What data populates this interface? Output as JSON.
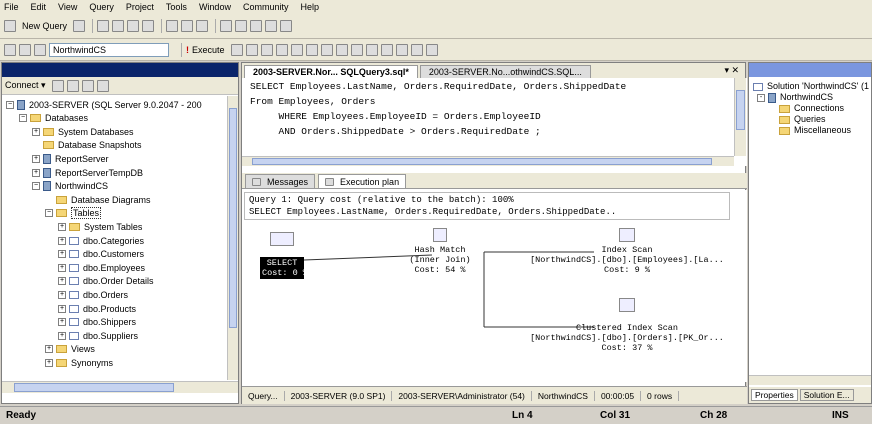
{
  "menu": [
    "File",
    "Edit",
    "View",
    "Query",
    "Project",
    "Tools",
    "Window",
    "Community",
    "Help"
  ],
  "toolbar": {
    "new_query_label": "New Query",
    "execute_label": "Execute",
    "database": "NorthwindCS"
  },
  "object_explorer": {
    "connect_label": "Connect ▾",
    "tree": [
      {
        "label": "2003-SERVER (SQL Server 9.0.2047 - 200",
        "indent": 0,
        "type": "server",
        "expander": "-"
      },
      {
        "label": "Databases",
        "indent": 1,
        "type": "folder",
        "expander": "-"
      },
      {
        "label": "System Databases",
        "indent": 2,
        "type": "folder",
        "expander": "+"
      },
      {
        "label": "Database Snapshots",
        "indent": 2,
        "type": "folder",
        "expander": ""
      },
      {
        "label": "ReportServer",
        "indent": 2,
        "type": "db",
        "expander": "+"
      },
      {
        "label": "ReportServerTempDB",
        "indent": 2,
        "type": "db",
        "expander": "+"
      },
      {
        "label": "NorthwindCS",
        "indent": 2,
        "type": "db",
        "expander": "-"
      },
      {
        "label": "Database Diagrams",
        "indent": 3,
        "type": "folder",
        "expander": ""
      },
      {
        "label": "Tables",
        "indent": 3,
        "type": "folder",
        "expander": "-",
        "selected": true
      },
      {
        "label": "System Tables",
        "indent": 4,
        "type": "folder",
        "expander": "+"
      },
      {
        "label": "dbo.Categories",
        "indent": 4,
        "type": "table",
        "expander": "+"
      },
      {
        "label": "dbo.Customers",
        "indent": 4,
        "type": "table",
        "expander": "+"
      },
      {
        "label": "dbo.Employees",
        "indent": 4,
        "type": "table",
        "expander": "+"
      },
      {
        "label": "dbo.Order Details",
        "indent": 4,
        "type": "table",
        "expander": "+"
      },
      {
        "label": "dbo.Orders",
        "indent": 4,
        "type": "table",
        "expander": "+"
      },
      {
        "label": "dbo.Products",
        "indent": 4,
        "type": "table",
        "expander": "+"
      },
      {
        "label": "dbo.Shippers",
        "indent": 4,
        "type": "table",
        "expander": "+"
      },
      {
        "label": "dbo.Suppliers",
        "indent": 4,
        "type": "table",
        "expander": "+"
      },
      {
        "label": "Views",
        "indent": 3,
        "type": "folder",
        "expander": "+"
      },
      {
        "label": "Synonyms",
        "indent": 3,
        "type": "folder",
        "expander": "+"
      }
    ]
  },
  "editor": {
    "tabs": [
      "2003-SERVER.Nor... SQLQuery3.sql*",
      "2003-SERVER.No...othwindCS.SQL..."
    ],
    "close_label": "▾ ✕",
    "sql_lines": [
      "SELECT Employees.LastName, Orders.RequiredDate, Orders.ShippedDate",
      "From Employees, Orders",
      "     WHERE Employees.EmployeeID = Orders.EmployeeID",
      "     AND Orders.ShippedDate > Orders.RequiredDate ;"
    ]
  },
  "results": {
    "tabs": [
      "Messages",
      "Execution plan"
    ],
    "query_header": "Query 1: Query cost (relative to the batch): 100%",
    "query_text": "SELECT Employees.LastName, Orders.RequiredDate, Orders.ShippedDate..",
    "nodes": {
      "select": {
        "name": "SELECT",
        "cost": "Cost: 0 %"
      },
      "hash": {
        "name": "Hash Match",
        "sub": "(Inner Join)",
        "cost": "Cost: 54 %"
      },
      "index": {
        "name": "Index Scan",
        "sub": "[NorthwindCS].[dbo].[Employees].[La...",
        "cost": "Cost: 9 %"
      },
      "clustered": {
        "name": "Clustered Index Scan",
        "sub": "[NorthwindCS].[dbo].[Orders].[PK_Or...",
        "cost": "Cost: 37 %"
      }
    }
  },
  "query_status": {
    "query": "Query...",
    "server": "2003-SERVER (9.0 SP1)",
    "user": "2003-SERVER\\Administrator (54)",
    "db": "NorthwindCS",
    "time": "00:00:05",
    "rows": "0 rows"
  },
  "solution": {
    "root": "Solution 'NorthwindCS' (1",
    "project": "NorthwindCS",
    "items": [
      "Connections",
      "Queries",
      "Miscellaneous"
    ],
    "tabs": [
      "Properties",
      "Solution E..."
    ]
  },
  "status": {
    "ready": "Ready",
    "ln": "Ln 4",
    "col": "Col 31",
    "ch": "Ch 28",
    "ins": "INS"
  }
}
